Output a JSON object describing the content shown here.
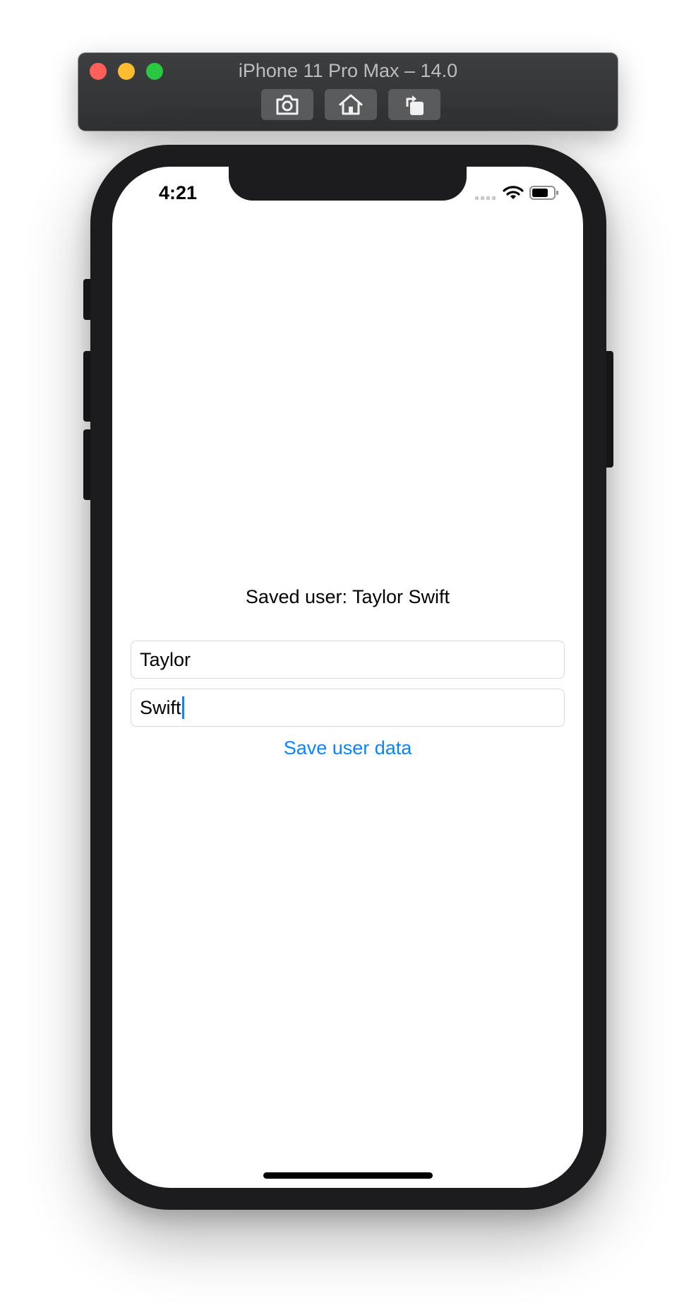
{
  "simulator": {
    "title": "iPhone 11 Pro Max – 14.0",
    "toolbar_buttons": [
      {
        "icon": "camera-icon",
        "label": "Screenshot"
      },
      {
        "icon": "home-icon",
        "label": "Home"
      },
      {
        "icon": "rotate-icon",
        "label": "Rotate"
      }
    ]
  },
  "status_bar": {
    "time": "4:21"
  },
  "content": {
    "saved_label": "Saved user: Taylor Swift",
    "first_name_value": "Taylor",
    "last_name_value": "Swift",
    "save_button_label": "Save user data"
  },
  "colors": {
    "accent": "#0a84ff",
    "close": "#fe5f57",
    "minimize": "#febc2e",
    "zoom": "#28c840"
  }
}
